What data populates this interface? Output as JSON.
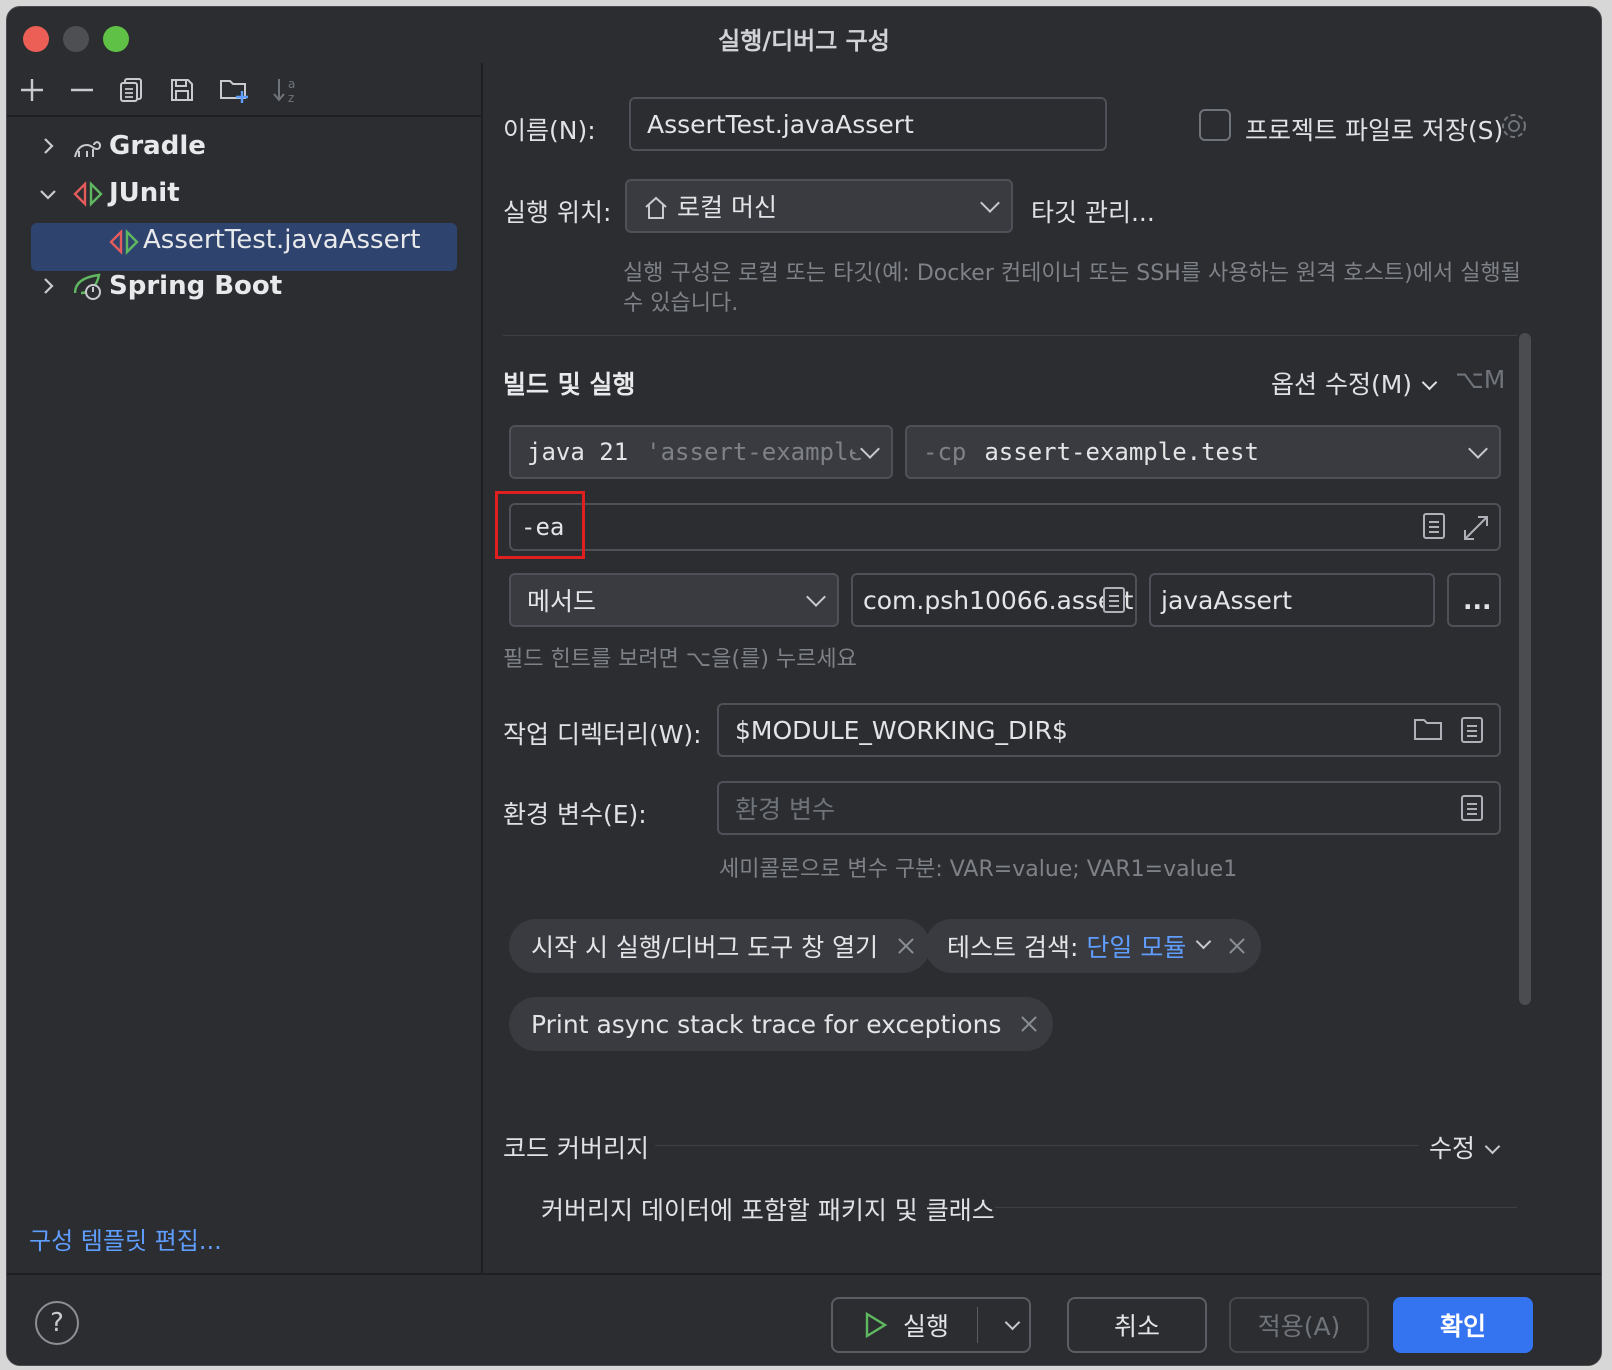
{
  "window": {
    "title": "실행/디버그 구성"
  },
  "toolbar": {
    "icons": [
      "plus-icon",
      "minus-icon",
      "copy-icon",
      "save-icon",
      "new-folder-icon",
      "sort-icon"
    ]
  },
  "tree": {
    "items": [
      {
        "label": "Gradle",
        "icon": "gradle-icon",
        "expanded": false
      },
      {
        "label": "JUnit",
        "icon": "junit-icon",
        "expanded": true
      },
      {
        "label": "AssertTest.javaAssert",
        "icon": "junit-test-icon",
        "selected": true
      },
      {
        "label": "Spring Boot",
        "icon": "spring-boot-icon",
        "expanded": false
      }
    ],
    "edit_templates_link": "구성 템플릿 편집..."
  },
  "form": {
    "name_label": "이름(N):",
    "name_value": "AssertTest.javaAssert",
    "save_project_label": "프로젝트 파일로 저장(S)",
    "run_on_label": "실행 위치:",
    "run_on_value": "로컬 머신",
    "manage_targets_link": "타깃 관리...",
    "run_on_hint": "실행 구성은 로컬 또는 타깃(예: Docker 컨테이너 또는 SSH를 사용하는 원격 호스트)에서 실행될 수 있습니다.",
    "build_run_section": "빌드 및 실행",
    "modify_options_link": "옵션 수정(M)",
    "modify_options_shortcut": "⌥M",
    "jre_value": "java 21",
    "jre_hint": "'assert-example'",
    "cp_prefix": "-cp",
    "cp_value": "assert-example.test",
    "vm_options_value": "-ea",
    "test_kind_value": "메서드",
    "class_value": "com.psh10066.assert",
    "method_value": "javaAssert",
    "more_button": "...",
    "field_hint": "필드 힌트를 보려면 ⌥을(를) 누르세요",
    "workdir_label": "작업 디렉터리(W):",
    "workdir_value": "$MODULE_WORKING_DIR$",
    "env_label": "환경 변수(E):",
    "env_placeholder": "환경 변수",
    "env_hint": "세미콜론으로 변수 구분: VAR=value; VAR1=value1",
    "chip_open_tool_window": "시작 시 실행/디버그 도구 창 열기",
    "chip_test_search_prefix": "테스트 검색:",
    "chip_test_search_value": "단일 모듈",
    "chip_async_stack": "Print async stack trace for exceptions",
    "coverage_section": "코드 커버리지",
    "coverage_modify": "수정",
    "coverage_packages": "커버리지 데이터에 포함할 패키지 및 클래스"
  },
  "footer": {
    "help": "?",
    "run_button": "실행",
    "cancel_button": "취소",
    "apply_button": "적용(A)",
    "ok_button": "확인"
  },
  "colors": {
    "accent": "#3574f0",
    "link": "#5f9dff",
    "highlight_box": "#e02020",
    "selection": "#2e436e"
  }
}
